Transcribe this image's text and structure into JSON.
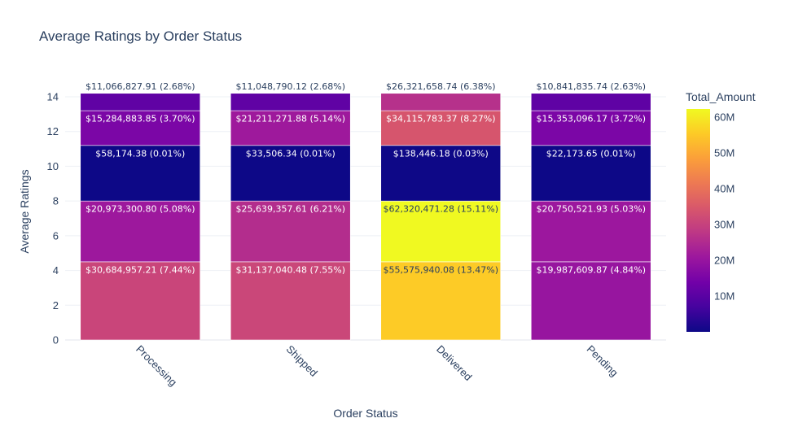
{
  "chart_data": {
    "type": "bar",
    "stacked": true,
    "title": "Average Ratings by Order Status",
    "xlabel": "Order Status",
    "ylabel": "Average Ratings",
    "ylim": [
      0,
      14.4
    ],
    "yticks": [
      "0",
      "2",
      "4",
      "6",
      "8",
      "10",
      "12",
      "14"
    ],
    "categories": [
      "Processing",
      "Shipped",
      "Delivered",
      "Pending"
    ],
    "grid": true,
    "colorbar": {
      "title": "Total_Amount",
      "range": [
        0,
        62320471.28
      ],
      "ticks": [
        "10M",
        "20M",
        "30M",
        "40M",
        "50M",
        "60M"
      ],
      "colors": [
        "#0d0887",
        "#46039f",
        "#7201a8",
        "#9c179e",
        "#bd3786",
        "#d8576b",
        "#ed7953",
        "#fb9f3a",
        "#fdca26",
        "#f0f921"
      ]
    },
    "series": [
      {
        "base": [
          0,
          0,
          0,
          0
        ],
        "values": [
          4.5,
          4.5,
          4.5,
          4.5
        ],
        "amounts": [
          30684957.21,
          31137040.48,
          55575940.08,
          19987609.87
        ],
        "labels": [
          "$30,684,957.21 (7.44%)",
          "$31,137,040.48 (7.55%)",
          "$55,575,940.08 (13.47%)",
          "$19,987,609.87 (4.84%)"
        ]
      },
      {
        "base": [
          4.5,
          4.5,
          4.5,
          4.5
        ],
        "values": [
          3.5,
          3.5,
          3.5,
          3.5
        ],
        "amounts": [
          20973300.8,
          25639357.61,
          62320471.28,
          20750521.93
        ],
        "labels": [
          "$20,973,300.80 (5.08%)",
          "$25,639,357.61 (6.21%)",
          "$62,320,471.28 (15.11%)",
          "$20,750,521.93 (5.03%)"
        ]
      },
      {
        "base": [
          8,
          8,
          8,
          8
        ],
        "values": [
          3.2,
          3.2,
          3.2,
          3.2
        ],
        "amounts": [
          58174.38,
          33506.34,
          138446.18,
          22173.65
        ],
        "labels": [
          "$58,174.38 (0.01%)",
          "$33,506.34 (0.01%)",
          "$138,446.18 (0.03%)",
          "$22,173.65 (0.01%)"
        ]
      },
      {
        "base": [
          11.2,
          11.2,
          11.2,
          11.2
        ],
        "values": [
          2.0,
          2.0,
          2.0,
          2.0
        ],
        "amounts": [
          15284883.85,
          21211271.88,
          34115783.37,
          15353096.17
        ],
        "labels": [
          "$15,284,883.85 (3.70%)",
          "$21,211,271.88 (5.14%)",
          "$34,115,783.37 (8.27%)",
          "$15,353,096.17 (3.72%)"
        ]
      },
      {
        "base": [
          13.2,
          13.2,
          13.2,
          13.2
        ],
        "values": [
          1.0,
          1.0,
          1.0,
          1.0
        ],
        "amounts": [
          11066827.91,
          11048790.12,
          26321658.74,
          10841835.74
        ],
        "labels": [
          "$11,066,827.91 (2.68%)",
          "$11,048,790.12 (2.68%)",
          "$26,321,658.74 (6.38%)",
          "$10,841,835.74 (2.63%)"
        ]
      }
    ]
  }
}
